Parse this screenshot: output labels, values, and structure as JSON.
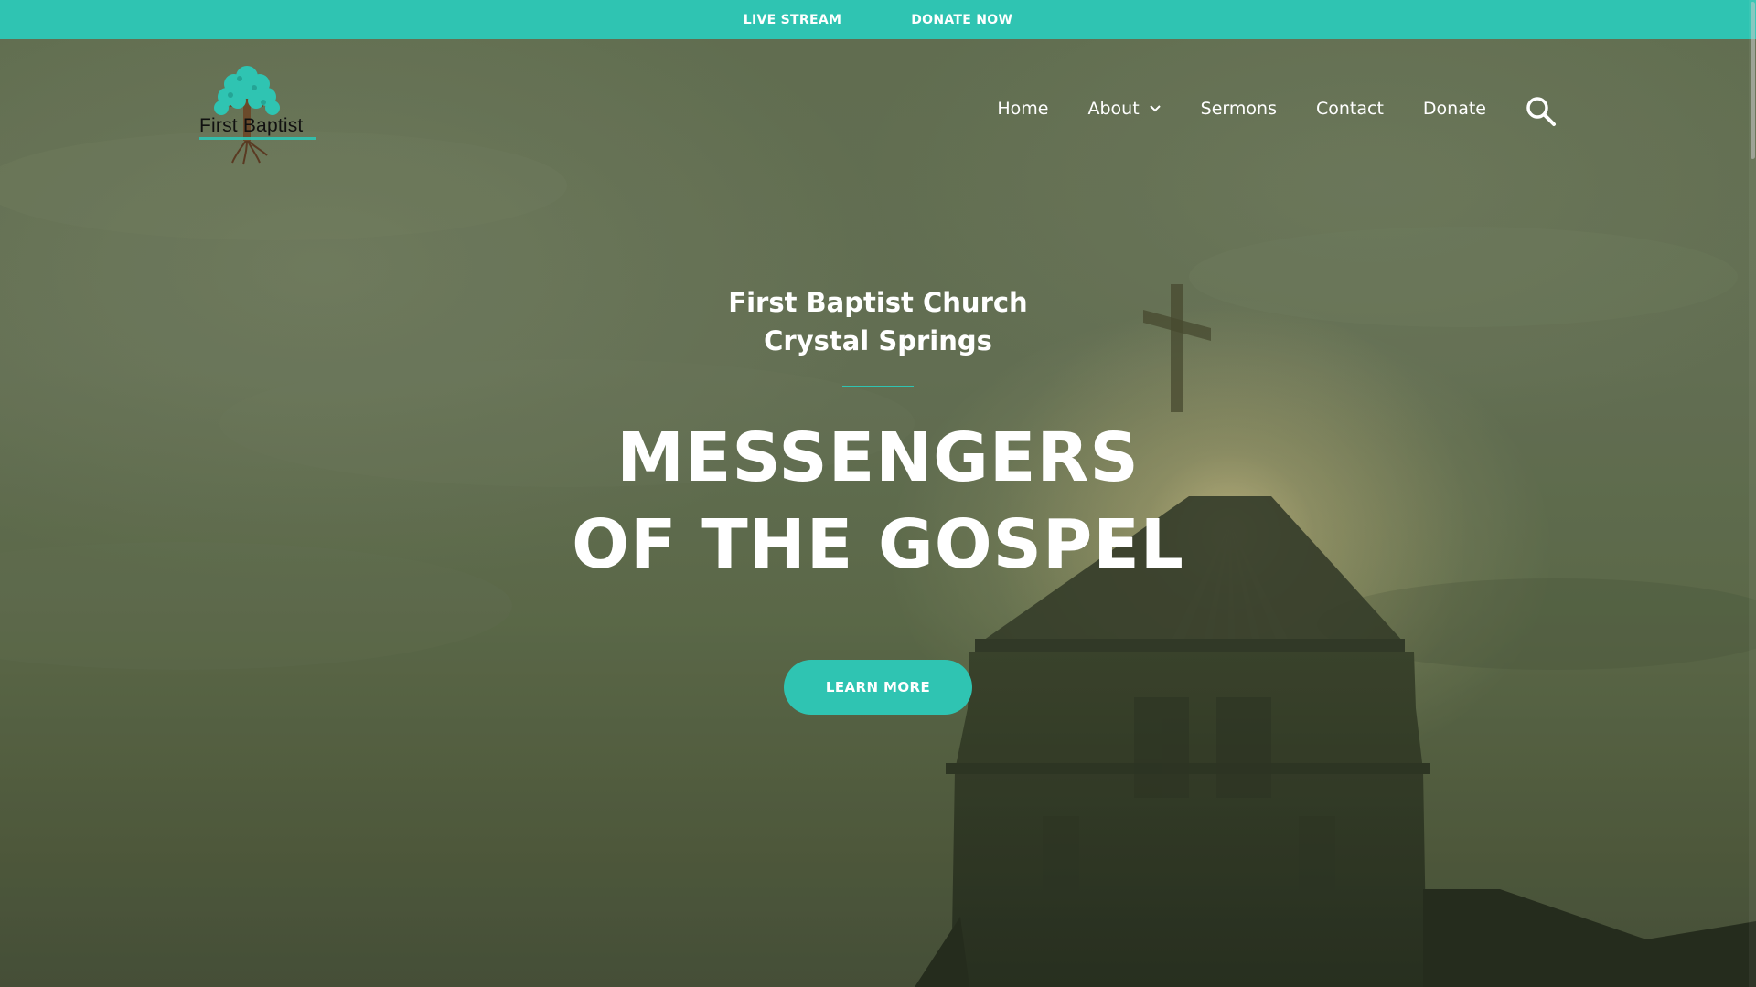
{
  "topbar": {
    "links": [
      {
        "label": "LIVE STREAM"
      },
      {
        "label": "DONATE NOW"
      }
    ]
  },
  "logo": {
    "text": "First Baptist",
    "icon": "tree-cross-icon"
  },
  "nav": {
    "items": [
      {
        "label": "Home"
      },
      {
        "label": "About",
        "has_dropdown": true
      },
      {
        "label": "Sermons"
      },
      {
        "label": "Contact"
      },
      {
        "label": "Donate"
      }
    ],
    "search_icon": "search-icon"
  },
  "hero": {
    "church_name_line1": "First Baptist Church",
    "church_name_line2": "Crystal Springs",
    "headline_line1": "MESSENGERS",
    "headline_line2": "OF THE GOSPEL",
    "cta_label": "LEARN MORE"
  },
  "colors": {
    "accent": "#2fc4b2",
    "text_light": "#ffffff",
    "logo_text": "#111111"
  }
}
